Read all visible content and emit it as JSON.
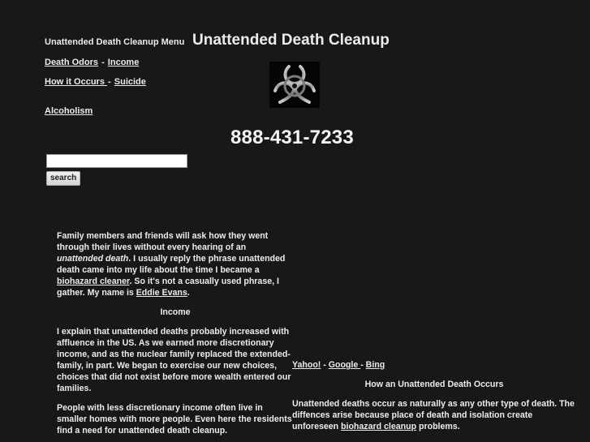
{
  "menu": {
    "title": "Unattended Death Cleanup Menu",
    "rows": [
      [
        {
          "label": "Death Odors"
        },
        {
          "label": "Income"
        }
      ],
      [
        {
          "label": "How it Occurs "
        },
        {
          "label": "Suicide"
        }
      ],
      [
        {
          "label": "Alcoholism"
        }
      ]
    ],
    "separator": " - "
  },
  "header": {
    "title": "Unattended Death Cleanup",
    "logo_icon": "biohazard-icon",
    "phone": "888-431-7233"
  },
  "search": {
    "value": "",
    "placeholder": "",
    "button_label": "search"
  },
  "article": {
    "intro": {
      "t1": "Family members and friends will ask how they went through their lives without every hearing of an ",
      "em": "unattended death",
      "t2": ". I usually reply the phrase unattended death came into my life about the time I became a ",
      "link1": "biohazard cleaner",
      "t3": ". So it's not a casually used phrase, I gather. My name is ",
      "link2": "Eddie Evans",
      "t4": "."
    },
    "income_heading": "Income",
    "income_p1": "I explain that unattended deaths probably increased with affluence in the US. As we earned more discretionary income, and as the nuclear family replaced the extended-family, in part. We began to exercise our new choices, choices that did not exist before more wealth entered our families.",
    "income_p2": "People with less discretionary income often live in smaller homes with more people. Even here the residents find a need for unattended death cleanup."
  },
  "right": {
    "engines": [
      {
        "label": "Yahoo!"
      },
      {
        "label": "Google "
      },
      {
        "label": "Bing"
      }
    ],
    "separator": " - ",
    "heading": "How an Unattended Death Occurs",
    "p": {
      "t1": "Unattended deaths occur as naturally as any other type of death. The diffences arise because place of death and isolation create unforeseen ",
      "link": "biohazard cleanup",
      "t2": " problems."
    }
  }
}
